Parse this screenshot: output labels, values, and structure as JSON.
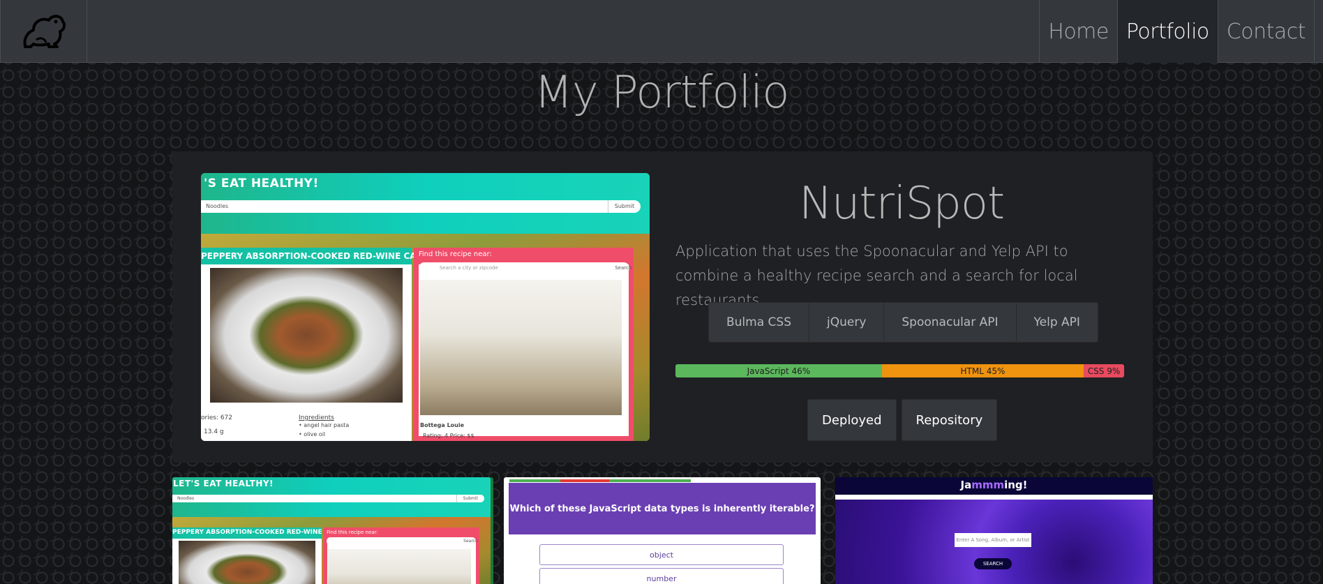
{
  "nav": {
    "links": [
      "Home",
      "Portfolio",
      "Contact"
    ]
  },
  "page_title": "My Portfolio",
  "featured": {
    "title": "NutriSpot",
    "description": "Application that uses the Spoonacular and Yelp API to combine a healthy recipe search and a search for local restaurants",
    "tags": [
      "Bulma CSS",
      "jQuery",
      "Spoonacular API",
      "Yelp API"
    ],
    "languages": [
      {
        "label": "JavaScript 46%",
        "percent": 46,
        "color": "#5cb85c"
      },
      {
        "label": "HTML 45%",
        "percent": 45,
        "color": "#f0930f"
      },
      {
        "label": "CSS 9%",
        "percent": 9,
        "color": "#e84a5f"
      }
    ],
    "buttons": {
      "deployed": "Deployed",
      "repository": "Repository"
    },
    "screenshot": {
      "header": "'S EAT HEALTHY!",
      "search_value": "Noodles",
      "submit": "Submit",
      "recipe_title": "PEPPERY ABSORPTION-COOKED RED-WINE CAPELLINI",
      "find_near": "Find this recipe near:",
      "city_placeholder": "Search a city or zipcode",
      "search_btn": "Search",
      "calories": "ories: 672",
      "grams": "13.4 g",
      "ingredients_label": "Ingredients",
      "ingredients": [
        "angel hair pasta",
        "olive oil"
      ],
      "restaurant": "Bottega Louie",
      "rating": "Rating: 4   Price: $$"
    }
  },
  "thumbs": {
    "nutri": {
      "header": "LET'S EAT HEALTHY!",
      "search_value": "Noodles",
      "submit": "Submit",
      "recipe_title": "PEPPERY ABSORPTION-COOKED RED-WINE CAPELLINI",
      "find_near": "Find this recipe near:",
      "search_btn": "Search"
    },
    "quiz": {
      "question": "Which of these JavaScript data types is inherently iterable?",
      "options": [
        "object",
        "number"
      ]
    },
    "jam": {
      "title_pre": "Ja",
      "title_mid": "mmm",
      "title_post": "ing!",
      "input_placeholder": "Enter A Song, Album, or Artist",
      "search": "SEARCH"
    }
  }
}
